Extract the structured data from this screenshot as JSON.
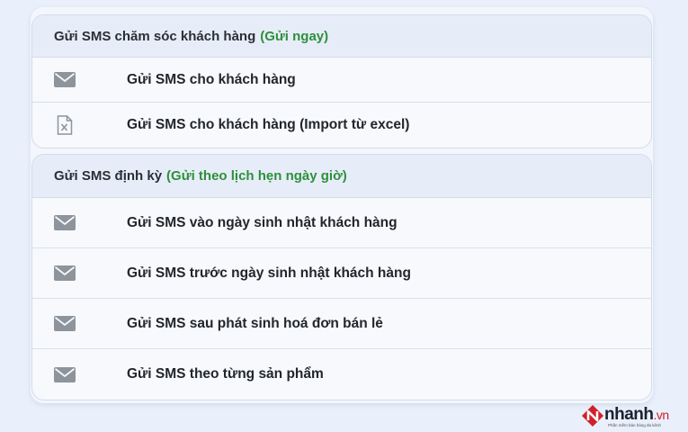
{
  "sections": [
    {
      "title": "Gửi SMS chăm sóc khách hàng",
      "note": "(Gửi ngay)",
      "items": [
        {
          "icon": "envelope-icon",
          "label": "Gửi SMS cho khách hàng"
        },
        {
          "icon": "excel-file-icon",
          "label": "Gửi SMS cho khách hàng (Import từ excel)"
        }
      ]
    },
    {
      "title": "Gửi SMS định kỳ",
      "note": "(Gửi theo lịch hẹn ngày giờ)",
      "items": [
        {
          "icon": "envelope-icon",
          "label": "Gửi SMS vào ngày sinh nhật khách hàng"
        },
        {
          "icon": "envelope-icon",
          "label": "Gửi SMS trước ngày sinh nhật khách hàng"
        },
        {
          "icon": "envelope-icon",
          "label": "Gửi SMS sau phát sinh hoá đơn bán lẻ"
        },
        {
          "icon": "envelope-icon",
          "label": "Gửi SMS theo từng sản phẩm"
        }
      ]
    }
  ],
  "logo": {
    "name": "nhanh",
    "tld": ".vn",
    "tagline": "Phần mềm bán hàng đa kênh"
  },
  "colors": {
    "accent_green": "#2f8f3c",
    "brand_red": "#d0202a",
    "icon_gray": "#8e949c"
  }
}
